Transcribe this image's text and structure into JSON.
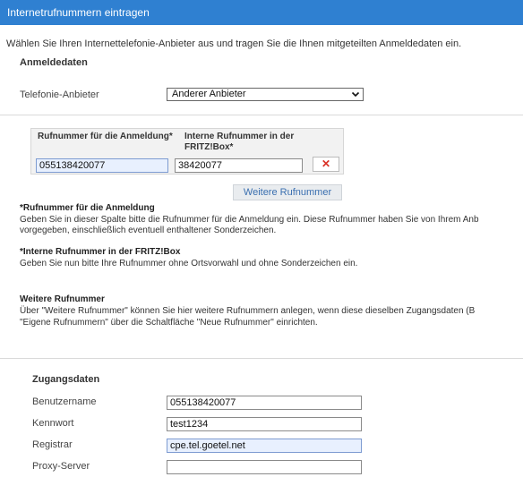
{
  "header": {
    "title": "Internetrufnummern eintragen"
  },
  "intro": "Wählen Sie Ihren Internettelefonie-Anbieter aus und tragen Sie die Ihnen mitgeteilten Anmeldedaten ein.",
  "login": {
    "section_title": "Anmeldedaten",
    "provider_label": "Telefonie-Anbieter",
    "provider_selected": "Anderer Anbieter"
  },
  "numbers_table": {
    "col1_header": "Rufnummer für die Anmeldung*",
    "col2_header_line1": "Interne Rufnummer in der",
    "col2_header_line2": "FRITZ!Box*",
    "rows": [
      {
        "login_number": "055138420077",
        "internal_number": "38420077",
        "delete_symbol": "✕"
      }
    ],
    "more_button_label": "Weitere Rufnummer"
  },
  "notes": {
    "n1_title": "*Rufnummer für die Anmeldung",
    "n1_line1": "Geben Sie in dieser Spalte bitte die Rufnummer für die Anmeldung ein. Diese Rufnummer haben Sie von Ihrem Anb",
    "n1_line2": "vorgegeben, einschließlich eventuell enthaltener Sonderzeichen.",
    "n2_title": "*Interne Rufnummer in der FRITZ!Box",
    "n2_line1": "Geben Sie nun bitte Ihre Rufnummer ohne Ortsvorwahl und ohne Sonderzeichen ein.",
    "n3_title": "Weitere Rufnummer",
    "n3_line1": "Über \"Weitere Rufnummer\" können Sie hier weitere Rufnummern anlegen, wenn diese dieselben Zugangsdaten (B",
    "n3_line2": "\"Eigene Rufnummern\" über die Schaltfläche \"Neue Rufnummer\" einrichten."
  },
  "access": {
    "section_title": "Zugangsdaten",
    "username_label": "Benutzername",
    "username_value": "055138420077",
    "password_label": "Kennwort",
    "password_value": "test1234",
    "registrar_label": "Registrar",
    "registrar_value": "cpe.tel.goetel.net",
    "proxy_label": "Proxy-Server",
    "proxy_value": ""
  },
  "colors": {
    "header_bg": "#2f80d1",
    "autofill_bg": "#e8f0fe",
    "delete_red": "#d93025",
    "link_blue": "#3a6fb0"
  }
}
